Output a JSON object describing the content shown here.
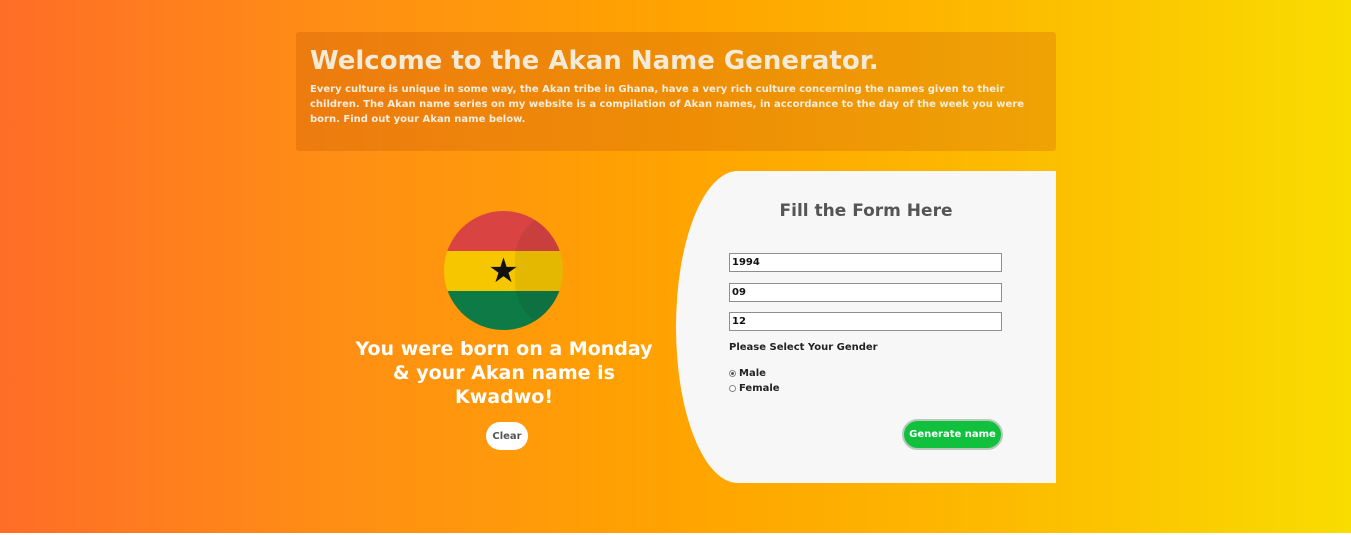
{
  "header": {
    "title": "Welcome to the Akan Name Generator.",
    "description": "Every culture is unique in some way, the Akan tribe in Ghana, have a very rich culture concerning the names given to their children. The Akan name series on my website is a compilation of Akan names, in accordance to the day of the week you were born. Find out your Akan name below."
  },
  "flag": {
    "icon": "ghana-flag-icon",
    "star_glyph": "★",
    "colors": {
      "red": "#d94443",
      "yellow": "#f6c601",
      "green": "#0e7a46"
    }
  },
  "result": {
    "message": "You were born on a Monday & your Akan name is Kwadwo!",
    "clear_label": "Clear"
  },
  "form": {
    "title": "Fill the Form Here",
    "year_value": "1994",
    "month_value": "09",
    "day_value": "12",
    "gender_label": "Please Select Your Gender",
    "gender_options": [
      {
        "label": "Male",
        "checked": true
      },
      {
        "label": "Female",
        "checked": false
      }
    ],
    "submit_label": "Generate name"
  },
  "colors": {
    "gradient_start": "#ff6d27",
    "gradient_end": "#f9dc00",
    "submit_button": "#11c03c",
    "panel": "#f7f7f7"
  }
}
